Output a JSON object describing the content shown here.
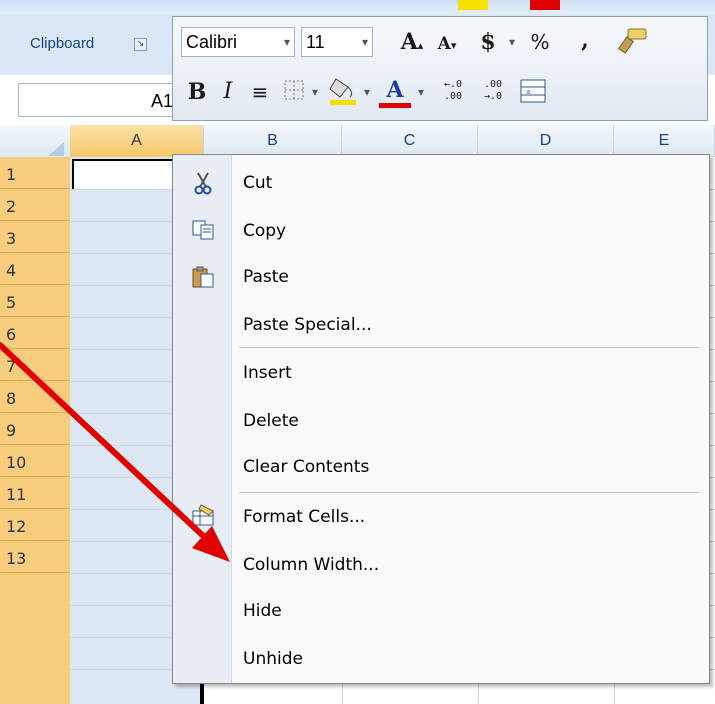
{
  "ribbon": {
    "clipboard_group": "Clipboard",
    "formula_name": "A1"
  },
  "mini_toolbar": {
    "font_name": "Calibri",
    "font_size": "11",
    "grow_font": "A",
    "shrink_font": "A",
    "currency": "$",
    "percent": "%",
    "comma": ",",
    "bold": "B",
    "italic": "I",
    "font_color": "A"
  },
  "columns": [
    "A",
    "B",
    "C",
    "D",
    "E"
  ],
  "rows": [
    "1",
    "2",
    "3",
    "4",
    "5",
    "6",
    "7",
    "8",
    "9",
    "10",
    "11",
    "12",
    "13"
  ],
  "context_menu": {
    "items": [
      {
        "label": "Cut",
        "icon": "scissors-icon"
      },
      {
        "label": "Copy",
        "icon": "copy-icon"
      },
      {
        "label": "Paste",
        "icon": "paste-icon"
      },
      {
        "label": "Paste Special..."
      },
      {
        "label": "Insert"
      },
      {
        "label": "Delete"
      },
      {
        "label": "Clear Contents"
      },
      {
        "label": "Format Cells...",
        "icon": "format-cells-icon"
      },
      {
        "label": "Column Width..."
      },
      {
        "label": "Hide"
      },
      {
        "label": "Unhide"
      }
    ]
  },
  "colors": {
    "arrow": "#e00000",
    "row_header": "#f9cd7e",
    "ribbon": "#dbe7f6"
  }
}
